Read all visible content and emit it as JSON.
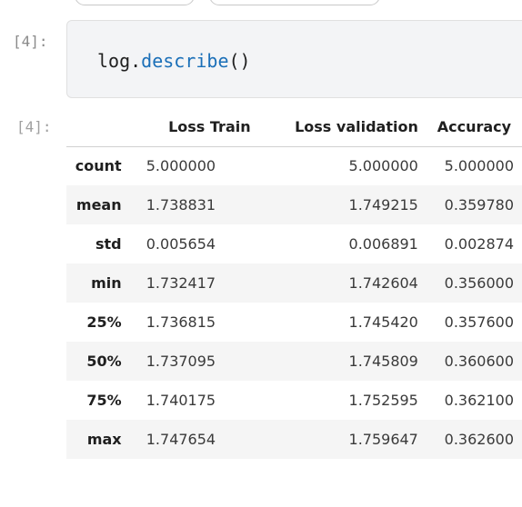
{
  "notebook": {
    "input_prompt": "[4]:",
    "output_prompt": "[4]:",
    "code": {
      "object": "log",
      "dot": ".",
      "method": "describe",
      "args": "()"
    }
  },
  "dataframe": {
    "columns": [
      "Loss Train",
      "Loss validation",
      "Accuracy"
    ],
    "rows": [
      {
        "index": "count",
        "values": [
          "5.000000",
          "5.000000",
          "5.000000"
        ]
      },
      {
        "index": "mean",
        "values": [
          "1.738831",
          "1.749215",
          "0.359780"
        ]
      },
      {
        "index": "std",
        "values": [
          "0.005654",
          "0.006891",
          "0.002874"
        ]
      },
      {
        "index": "min",
        "values": [
          "1.732417",
          "1.742604",
          "0.356000"
        ]
      },
      {
        "index": "25%",
        "values": [
          "1.736815",
          "1.745420",
          "0.357600"
        ]
      },
      {
        "index": "50%",
        "values": [
          "1.737095",
          "1.745809",
          "0.360600"
        ]
      },
      {
        "index": "75%",
        "values": [
          "1.740175",
          "1.752595",
          "0.362100"
        ]
      },
      {
        "index": "max",
        "values": [
          "1.747654",
          "1.759647",
          "0.362600"
        ]
      }
    ]
  },
  "colors": {
    "code_cell_bg": "#f3f4f6",
    "method_color": "#1a6fb8",
    "striped_row_bg": "#f5f5f5",
    "prompt_color": "#8a8a8a"
  }
}
